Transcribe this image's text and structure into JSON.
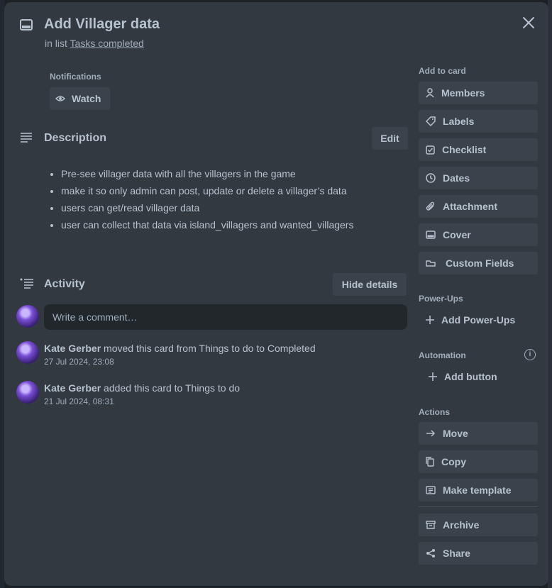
{
  "card": {
    "title": "Add Villager data",
    "in_list_prefix": "in list",
    "list_name": "Tasks completed"
  },
  "notifications": {
    "label": "Notifications",
    "watch_label": "Watch"
  },
  "description": {
    "heading": "Description",
    "edit_label": "Edit",
    "items": [
      "Pre-see villager data with all the villagers in the game",
      "make it so only admin can post, update or delete a villager’s data",
      "users can get/read villager data",
      "user can collect that data via island_villagers and wanted_villagers"
    ]
  },
  "activity": {
    "heading": "Activity",
    "hide_details_label": "Hide details",
    "comment_placeholder": "Write a comment…",
    "entries": [
      {
        "user": "Kate Gerber",
        "text": "moved this card from Things to do to Completed",
        "time": "27 Jul 2024, 23:08"
      },
      {
        "user": "Kate Gerber",
        "text": "added this card to Things to do",
        "time": "21 Jul 2024, 08:31"
      }
    ]
  },
  "sidebar": {
    "add_to_card_label": "Add to card",
    "add_to_card": [
      "Members",
      "Labels",
      "Checklist",
      "Dates",
      "Attachment",
      "Cover",
      "Custom Fields"
    ],
    "powerups_label": "Power-Ups",
    "add_powerups": "Add Power-Ups",
    "automation_label": "Automation",
    "add_button": "Add button",
    "info_glyph": "i",
    "actions_label": "Actions",
    "actions": [
      "Move",
      "Copy",
      "Make template",
      "Archive",
      "Share"
    ]
  },
  "icons": {
    "card": "card-icon",
    "close": "close-icon",
    "eye": "eye-icon",
    "description": "description-icon",
    "activity": "activity-icon",
    "member": "person-icon",
    "label": "tag-icon",
    "checklist": "checkbox-icon",
    "dates": "clock-icon",
    "attachment": "paperclip-icon",
    "cover": "cover-icon",
    "custom_fields": "field-icon",
    "plus": "plus-icon",
    "info": "info-icon",
    "move": "arrow-right-icon",
    "copy": "copy-icon",
    "template": "template-icon",
    "archive": "archive-icon",
    "share": "share-icon"
  },
  "colors": {
    "modal_bg": "#323940",
    "button_bg": "#3a424b",
    "text": "#b6c2cf",
    "subtle": "#9fadbc",
    "input_bg": "#22272b"
  }
}
